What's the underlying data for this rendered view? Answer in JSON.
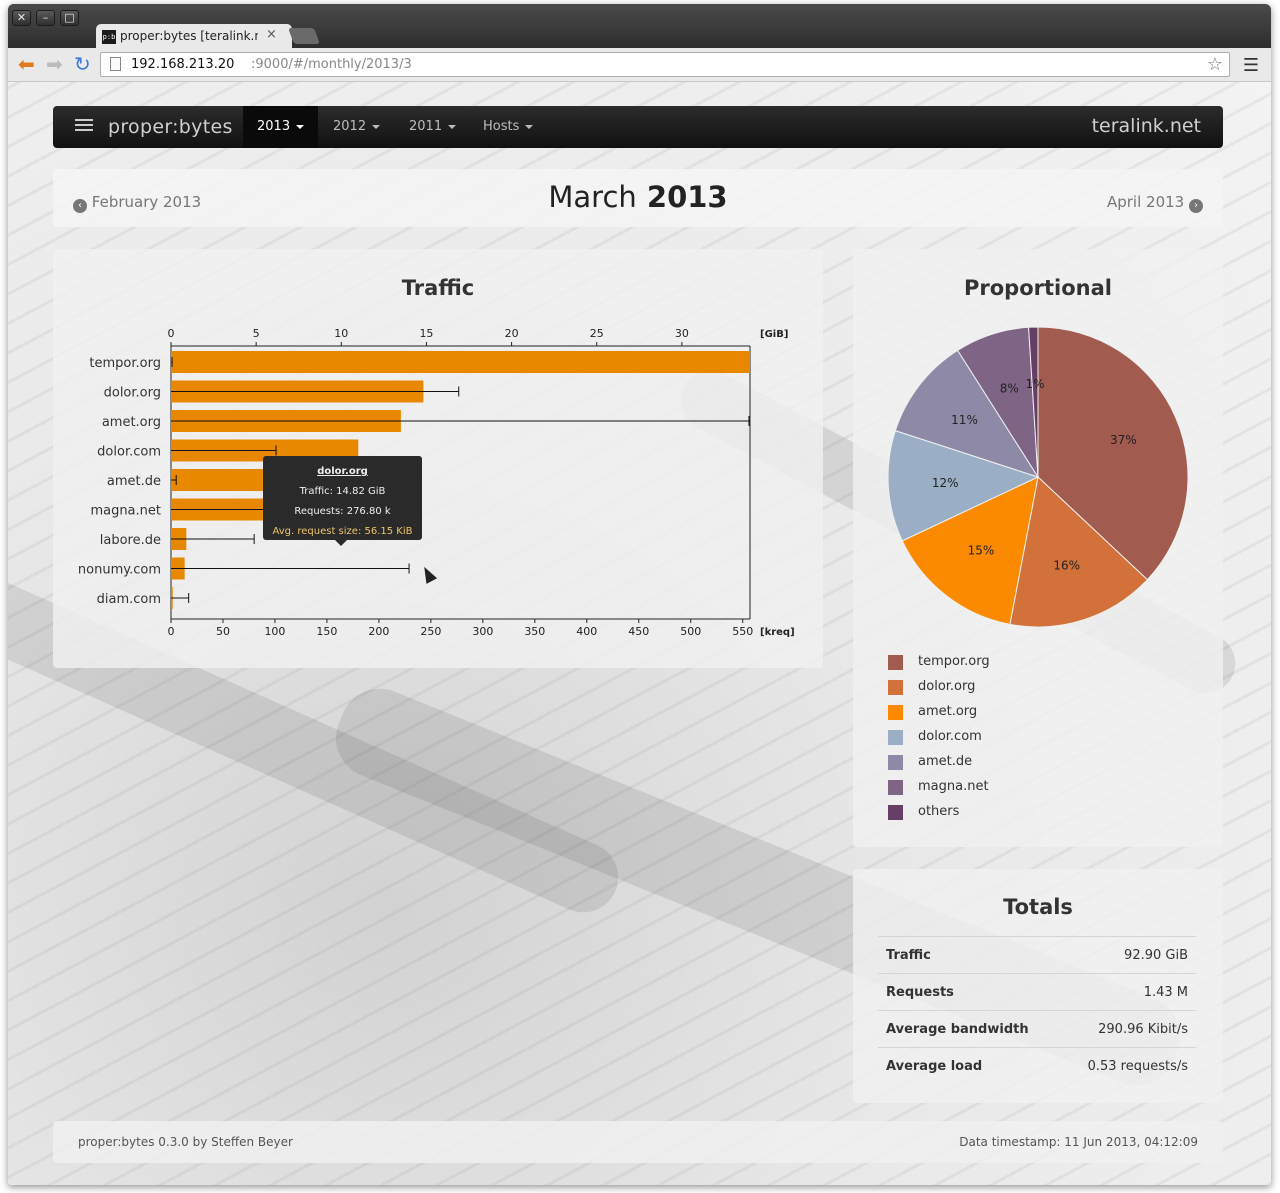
{
  "browser": {
    "tab_title": "proper:bytes [teralink.net]",
    "tab_favicon": "p:b",
    "url_host": "192.168.213.20",
    "url_rest": ":9000/#/monthly/2013/3"
  },
  "navbar": {
    "brand": "proper:bytes",
    "items": [
      {
        "label": "2013"
      },
      {
        "label": "2012"
      },
      {
        "label": "2011"
      },
      {
        "label": "Hosts"
      }
    ],
    "right": "teralink.net"
  },
  "month": {
    "prev": "February 2013",
    "title_month": "March",
    "title_year": "2013",
    "next": "April 2013"
  },
  "traffic": {
    "title": "Traffic",
    "tooltip": {
      "host": "dolor.org",
      "traffic": "Traffic: 14.82 GiB",
      "requests": "Requests: 276.80 k",
      "avg": "Avg. request size: 56.15 KiB"
    }
  },
  "proportional": {
    "title": "Proportional"
  },
  "totals": {
    "title": "Totals",
    "rows": [
      {
        "label": "Traffic",
        "value": "92.90 GiB"
      },
      {
        "label": "Requests",
        "value": "1.43 M"
      },
      {
        "label": "Average bandwidth",
        "value": "290.96 Kibit/s"
      },
      {
        "label": "Average load",
        "value": "0.53 requests/s"
      }
    ]
  },
  "footer": {
    "left": "proper:bytes 0.3.0 by Steffen Beyer",
    "right": "Data timestamp: 11 Jun 2013, 04:12:09"
  },
  "chart_data": [
    {
      "type": "bar",
      "title": "Traffic",
      "categories": [
        "tempor.org",
        "dolor.org",
        "amet.org",
        "dolor.com",
        "amet.de",
        "magna.net",
        "labore.de",
        "nonumy.com",
        "diam.com"
      ],
      "series": [
        {
          "name": "",
          "unit": "GiB",
          "values": [
            34.0,
            14.82,
            13.5,
            11.0,
            10.1,
            7.5,
            0.9,
            0.8,
            0.1
          ],
          "color": "#e88800"
        },
        {
          "name": "",
          "unit": "kreq",
          "values": [
            1,
            276.8,
            556,
            101,
            5,
            155,
            80,
            229,
            17
          ],
          "color": "#111111"
        }
      ],
      "x_axis_top": {
        "label": "[GiB]",
        "ticks": [
          0,
          5,
          10,
          15,
          20,
          25,
          30
        ],
        "range": [
          0,
          34
        ]
      },
      "x_axis_bottom": {
        "label": "[kreq]",
        "ticks": [
          0,
          50,
          100,
          150,
          200,
          250,
          300,
          350,
          400,
          450,
          500,
          550
        ],
        "range": [
          0,
          557
        ]
      }
    },
    {
      "type": "pie",
      "title": "Proportional",
      "labels": [
        "tempor.org",
        "dolor.org",
        "amet.org",
        "dolor.com",
        "amet.de",
        "magna.net",
        "others"
      ],
      "values": [
        37,
        16,
        15,
        12,
        11,
        8,
        1
      ],
      "value_labels": [
        "37%",
        "16%",
        "15%",
        "12%",
        "11%",
        "8%",
        "1%"
      ],
      "colors": [
        "#a15b4f",
        "#d2723a",
        "#fb8a00",
        "#9aafc6",
        "#8e89a6",
        "#7e6586",
        "#663f66"
      ]
    }
  ]
}
